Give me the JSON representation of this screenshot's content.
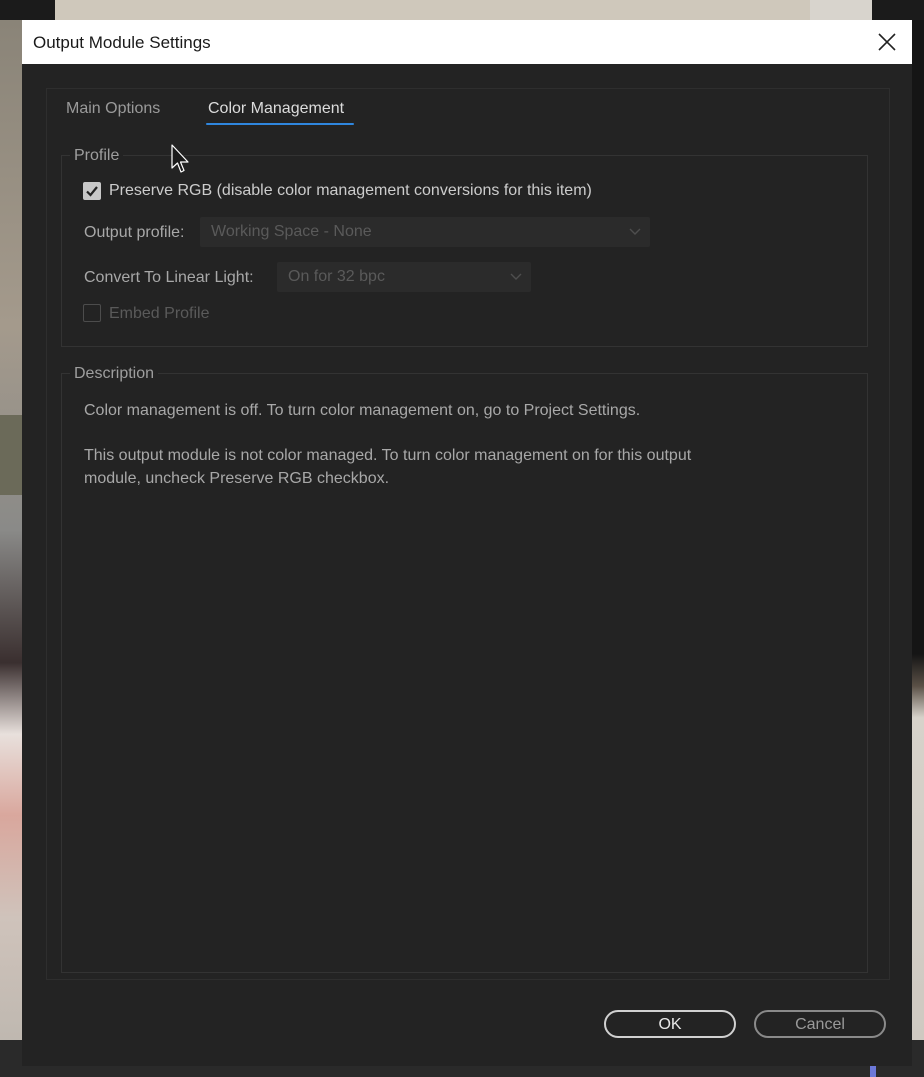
{
  "window": {
    "title": "Output Module Settings"
  },
  "tabs": [
    {
      "label": "Main Options",
      "active": false
    },
    {
      "label": "Color Management",
      "active": true
    }
  ],
  "profile": {
    "group_label": "Profile",
    "preserve_rgb": {
      "label": "Preserve RGB (disable color management conversions for this item)",
      "checked": true
    },
    "output_profile": {
      "label": "Output profile:",
      "value": "Working Space - None",
      "enabled": false
    },
    "linear_light": {
      "label": "Convert To Linear Light:",
      "value": "On for 32 bpc",
      "enabled": false
    },
    "embed_profile": {
      "label": "Embed Profile",
      "checked": false,
      "enabled": false
    }
  },
  "description": {
    "group_label": "Description",
    "line1": "Color management is off. To turn color management on, go to Project Settings.",
    "line2": "This output module is not color managed. To turn color management on for this output module, uncheck Preserve RGB checkbox."
  },
  "buttons": {
    "ok": "OK",
    "cancel": "Cancel"
  },
  "colors": {
    "accent": "#2f86de",
    "dialog_bg": "#232323",
    "titlebar_bg": "#ffffff"
  },
  "icons": {
    "close": "close-icon",
    "checkmark": "checkmark-icon",
    "dropdown": "chevron-down-icon",
    "cursor": "mouse-cursor-icon"
  }
}
